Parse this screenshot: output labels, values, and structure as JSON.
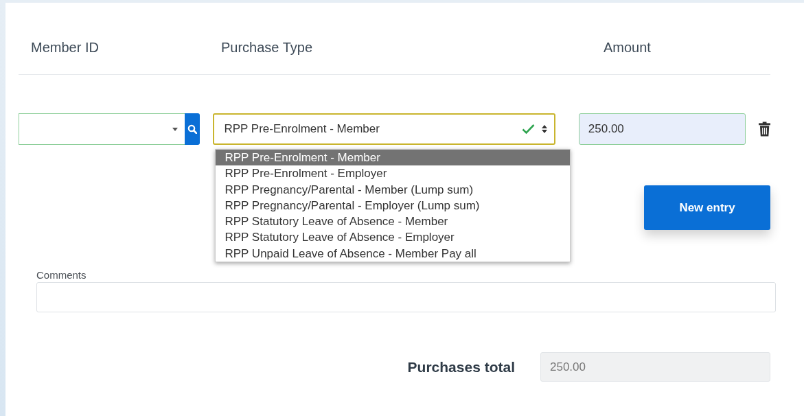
{
  "columns": [
    "Member ID",
    "Purchase Type",
    "Amount"
  ],
  "purchase_type": {
    "value": "RPP Pre-Enrolment - Member",
    "valid": true,
    "expanded": true,
    "options": [
      {
        "label": "RPP Pre-Enrolment - Member",
        "selected": true
      },
      {
        "label": "RPP Pre-Enrolment - Employer",
        "selected": false
      },
      {
        "label": "RPP Pregnancy/Parental - Member (Lump sum)",
        "selected": false
      },
      {
        "label": "RPP Pregnancy/Parental - Employer (Lump sum)",
        "selected": false
      },
      {
        "label": "RPP Statutory Leave of Absence - Member",
        "selected": false
      },
      {
        "label": "RPP Statutory Leave of Absence - Employer",
        "selected": false
      },
      {
        "label": "RPP Unpaid Leave of Absence - Member Pay all",
        "selected": false
      }
    ]
  },
  "amount": {
    "value": "250.00"
  },
  "new_entry_button": "New entry",
  "comments": {
    "label": "Comments"
  },
  "total": {
    "label": "Purchases total",
    "value": "250.00",
    "disabled": true
  }
}
